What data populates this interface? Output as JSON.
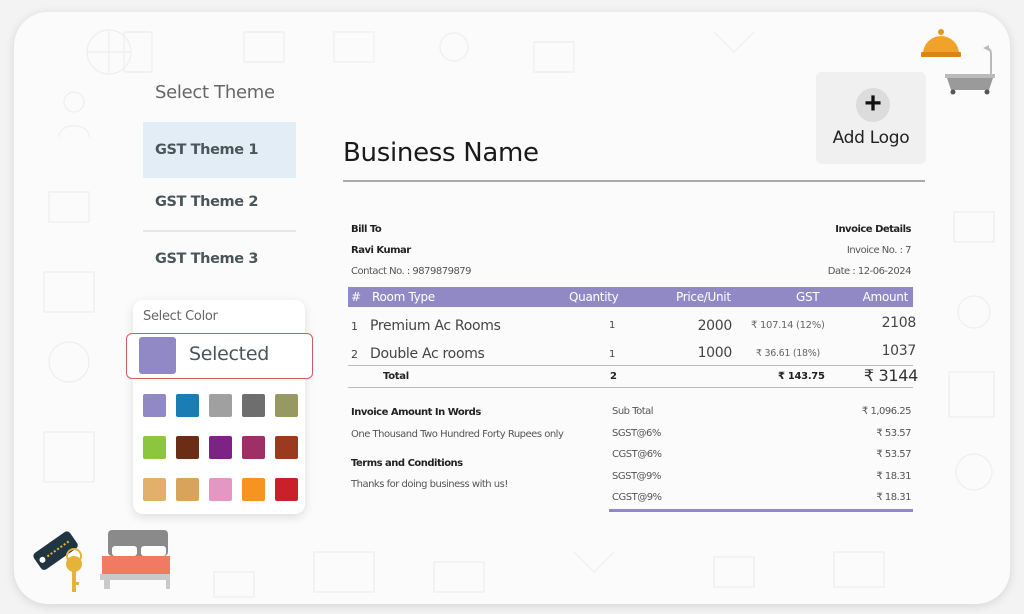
{
  "theme_panel": {
    "title": "Select Theme",
    "themes": [
      {
        "label": "GST Theme 1",
        "active": true
      },
      {
        "label": "GST Theme 2",
        "active": false
      },
      {
        "label": "GST Theme 3",
        "active": false
      }
    ]
  },
  "color_panel": {
    "title": "Select Color",
    "selected_label": "Selected",
    "selected_color": "#9189c6",
    "swatches": [
      "#9189c6",
      "#1a7db3",
      "#a0a0a0",
      "#6e6e6e",
      "#969a62",
      "#8cc63e",
      "#6b2d16",
      "#7d2385",
      "#9d3166",
      "#9a3a1e",
      "#e2b06a",
      "#d8a35a",
      "#e597c4",
      "#f69321",
      "#c9202a"
    ]
  },
  "invoice": {
    "business_name": "Business Name",
    "add_logo_label": "Add Logo",
    "bill_to_label": "Bill To",
    "customer_name": "Ravi Kumar",
    "contact": "Contact No. : 9879879879",
    "details_label": "Invoice Details",
    "invoice_no": "Invoice No. : 7",
    "date": "Date : 12-06-2024",
    "accent_color": "#9189c6",
    "columns": [
      "#",
      "Room Type",
      "Quantity",
      "Price/Unit",
      "GST",
      "Amount"
    ],
    "rows": [
      {
        "num": "1",
        "room_type": "Premium Ac Rooms",
        "quantity": "1",
        "price": "2000",
        "gst": "₹ 107.14 (12%)",
        "amount": "2108"
      },
      {
        "num": "2",
        "room_type": "Double Ac rooms",
        "quantity": "1",
        "price": "1000",
        "gst": "₹ 36.61 (18%)",
        "amount": "1037"
      }
    ],
    "total": {
      "label": "Total",
      "quantity": "2",
      "gst": "₹ 143.75",
      "amount": "₹ 3144"
    },
    "amount_words_label": "Invoice Amount In Words",
    "amount_words": "One Thousand Two Hundred Forty Rupees only",
    "terms_label": "Terms and Conditions",
    "terms": "Thanks for doing business with us!",
    "summary": [
      {
        "label": "Sub Total",
        "value": "₹ 1,096.25"
      },
      {
        "label": "SGST@6%",
        "value": "₹ 53.57"
      },
      {
        "label": "CGST@6%",
        "value": "₹ 53.57"
      },
      {
        "label": "SGST@9%",
        "value": "₹ 18.31"
      },
      {
        "label": "CGST@9%",
        "value": "₹ 18.31"
      }
    ]
  }
}
